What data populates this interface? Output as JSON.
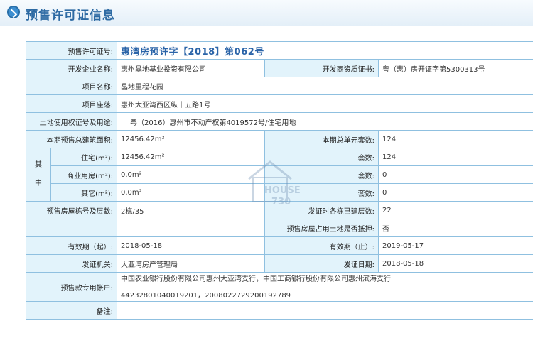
{
  "header": {
    "title": "预售许可证信息"
  },
  "rows": {
    "permit_no": {
      "label": "预售许可证号:",
      "value": "惠湾房预许字【2018】第062号"
    },
    "developer": {
      "label": "开发企业名称:",
      "value": "惠州晶地基业投资有限公司"
    },
    "dev_cert": {
      "label": "开发商资质证书:",
      "value": "粤（惠）房开证字第5300313号"
    },
    "project_name": {
      "label": "项目名称:",
      "value": "晶地里程花园"
    },
    "project_location": {
      "label": "项目座落:",
      "value": "惠州大亚湾西区纵十五路1号"
    },
    "land_cert": {
      "label": "土地使用权证号及用途:",
      "value": "粤（2016）惠州市不动产权第4019572号/住宅用地"
    },
    "presale_area": {
      "label": "本期预售总建筑面积:",
      "value": "12456.42m²"
    },
    "total_units": {
      "label": "本期总单元套数:",
      "value": "124"
    },
    "of_which": {
      "label": "其中"
    },
    "residential_area": {
      "label": "住宅(m²):",
      "value": "12456.42m²"
    },
    "residential_units": {
      "label": "套数:",
      "value": "124"
    },
    "commercial_area": {
      "label": "商业用房(m²):",
      "value": "0.0m²"
    },
    "commercial_units": {
      "label": "套数:",
      "value": "0"
    },
    "other_area": {
      "label": "其它(m²):",
      "value": "0.0m²"
    },
    "other_units": {
      "label": "套数:",
      "value": "0"
    },
    "buildings_floors": {
      "label": "预售房屋栋号及层数:",
      "value": "2栋/35"
    },
    "built_floors": {
      "label": "发证时各栋已建层数:",
      "value": "22"
    },
    "mortgage": {
      "label": "预售房屋占用土地是否抵押:",
      "value": "否"
    },
    "valid_from": {
      "label": "有效期（起）:",
      "value": "2018-05-18"
    },
    "valid_to": {
      "label": "有效期（止）:",
      "value": "2019-05-17"
    },
    "issuer": {
      "label": "发证机关:",
      "value": "大亚湾房产管理局"
    },
    "issue_date": {
      "label": "发证日期:",
      "value": "2018-05-18"
    },
    "account": {
      "label": "预售款专用帐户:",
      "line1": "中国农业银行股份有限公司惠州大亚湾支行，中国工商银行股份有限公司惠州滨海支行",
      "line2": "44232801040019201，2008022729200192789"
    },
    "remarks": {
      "label": "备注:",
      "value": ""
    }
  },
  "watermark": {
    "line1": "HOUSE",
    "line2": "730"
  }
}
